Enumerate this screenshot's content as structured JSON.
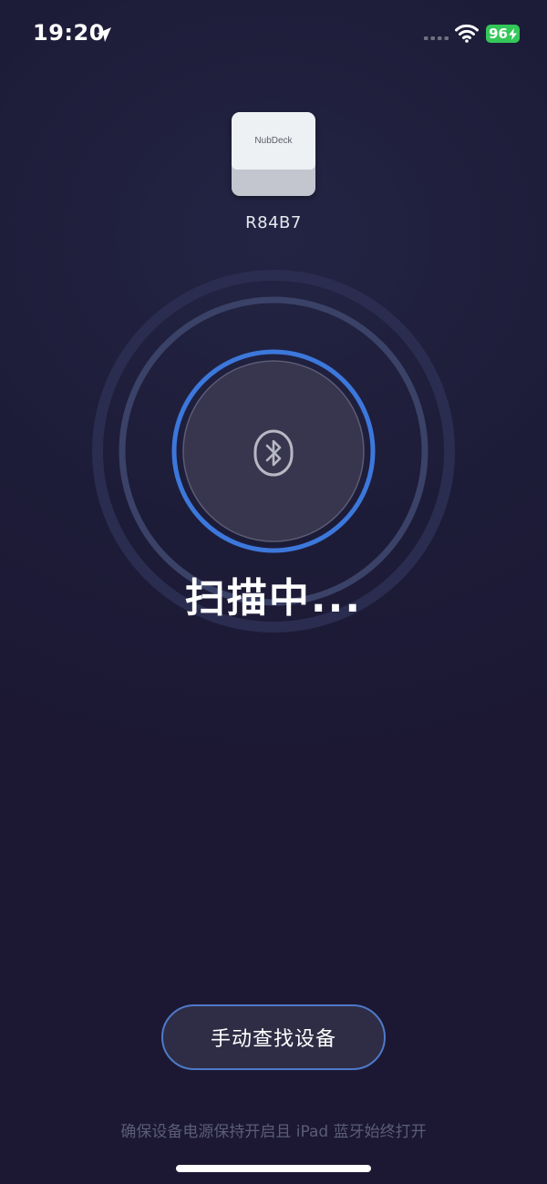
{
  "status_bar": {
    "time": "19:20",
    "battery_level": "96",
    "location_icon": "location-arrow-icon",
    "signal_icon": "cellular-signal-icon",
    "wifi_icon": "wifi-icon",
    "battery_icon": "charging-bolt-icon"
  },
  "device": {
    "brand_label": "NubDeck",
    "name": "R84B7",
    "icon": "keycap-icon"
  },
  "scanner": {
    "icon": "bluetooth-icon",
    "status_text": "扫描中..."
  },
  "actions": {
    "manual_search_label": "手动查找设备"
  },
  "footer": {
    "hint": "确保设备电源保持开启且 iPad 蓝牙始终打开"
  },
  "colors": {
    "background": "#1d1c38",
    "accent_ring": "#3c78dc",
    "battery": "#34c759",
    "hint_text": "#5b5d76"
  }
}
